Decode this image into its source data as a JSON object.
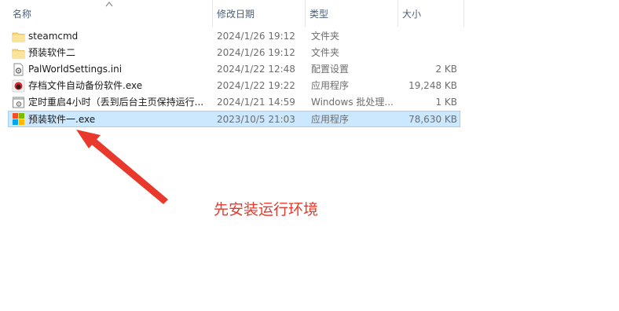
{
  "columns": {
    "name": "名称",
    "date": "修改日期",
    "type": "类型",
    "size": "大小"
  },
  "files": [
    {
      "name": "steamcmd",
      "date": "2024/1/26 19:12",
      "type": "文件夹",
      "size": "",
      "icon": "folder-icon"
    },
    {
      "name": "预装软件二",
      "date": "2024/1/26 19:12",
      "type": "文件夹",
      "size": "",
      "icon": "folder-icon"
    },
    {
      "name": "PalWorldSettings.ini",
      "date": "2024/1/22 12:48",
      "type": "配置设置",
      "size": "2 KB",
      "icon": "settings-file-icon"
    },
    {
      "name": "存档文件自动备份软件.exe",
      "date": "2024/1/22 19:22",
      "type": "应用程序",
      "size": "19,248 KB",
      "icon": "app-red-icon"
    },
    {
      "name": "定时重启4小时（丢到后台主页保持运行...",
      "date": "2024/1/21 14:59",
      "type": "Windows 批处理...",
      "size": "1 KB",
      "icon": "batch-file-icon"
    },
    {
      "name": "预装软件一.exe",
      "date": "2023/10/5 21:03",
      "type": "应用程序",
      "size": "78,630 KB",
      "icon": "windows-app-icon",
      "selected": true
    }
  ],
  "annotation": {
    "text": "先安装运行环境",
    "color": "#e8392c"
  },
  "colors": {
    "selection_bg": "#cce8ff",
    "selection_border": "#99d1ff",
    "header_text": "#4c607a",
    "folder": "#f8d775"
  }
}
